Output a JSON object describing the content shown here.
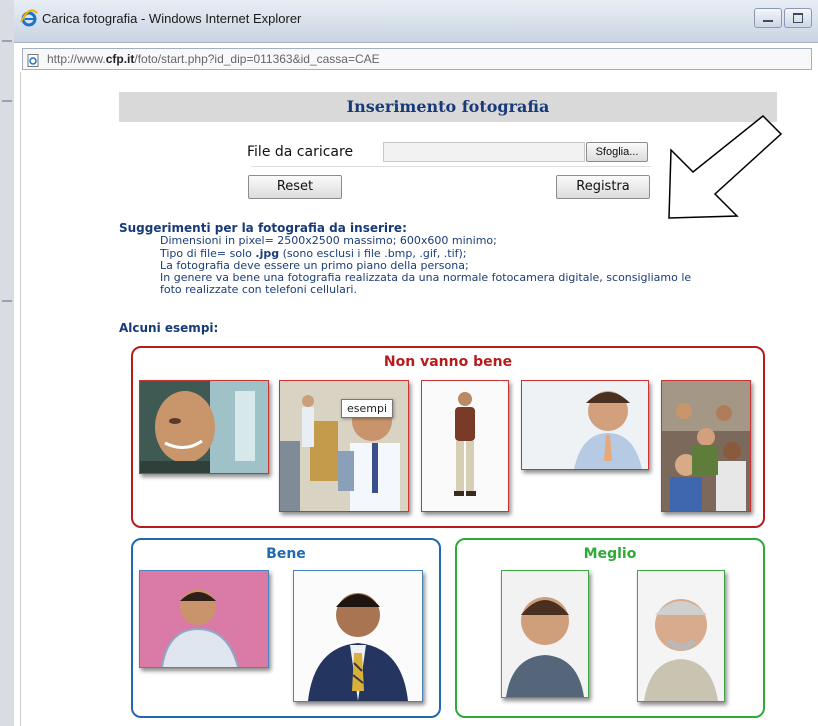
{
  "window": {
    "title": "Carica fotografia - Windows Internet Explorer",
    "address_prefix": "http://www.",
    "address_domain": "cfp.it",
    "address_rest": "/foto/start.php?id_dip=011363&id_cassa=CAE"
  },
  "form": {
    "heading": "Inserimento fotografia",
    "file_label": "File da caricare",
    "file_value": "",
    "browse_label": "Sfoglia...",
    "reset_label": "Reset",
    "submit_label": "Registra"
  },
  "tips": {
    "title": "Suggerimenti per la fotografia da inserire:",
    "line1": "Dimensioni in pixel= 2500x2500 massimo; 600x600 minimo;",
    "line2_pre": "Tipo di file= solo ",
    "line2_bold": ".jpg",
    "line2_post": " (sono esclusi i file .bmp, .gif, .tif);",
    "line3": "La fotografia deve essere un primo piano della persona;",
    "line4": "In genere va bene una fotografia realizzata da una normale fotocamera digitale, sconsigliamo le",
    "line5": "foto realizzate con telefoni cellulari."
  },
  "examples": {
    "title": "Alcuni esempi:",
    "bad_title": "Non vanno bene",
    "good_title": "Bene",
    "better_title": "Meglio",
    "tooltip": "esempi"
  },
  "colors": {
    "bad": "#b71c1c",
    "good": "#1f6ab3",
    "better": "#2eab36",
    "heading": "#173a78"
  }
}
